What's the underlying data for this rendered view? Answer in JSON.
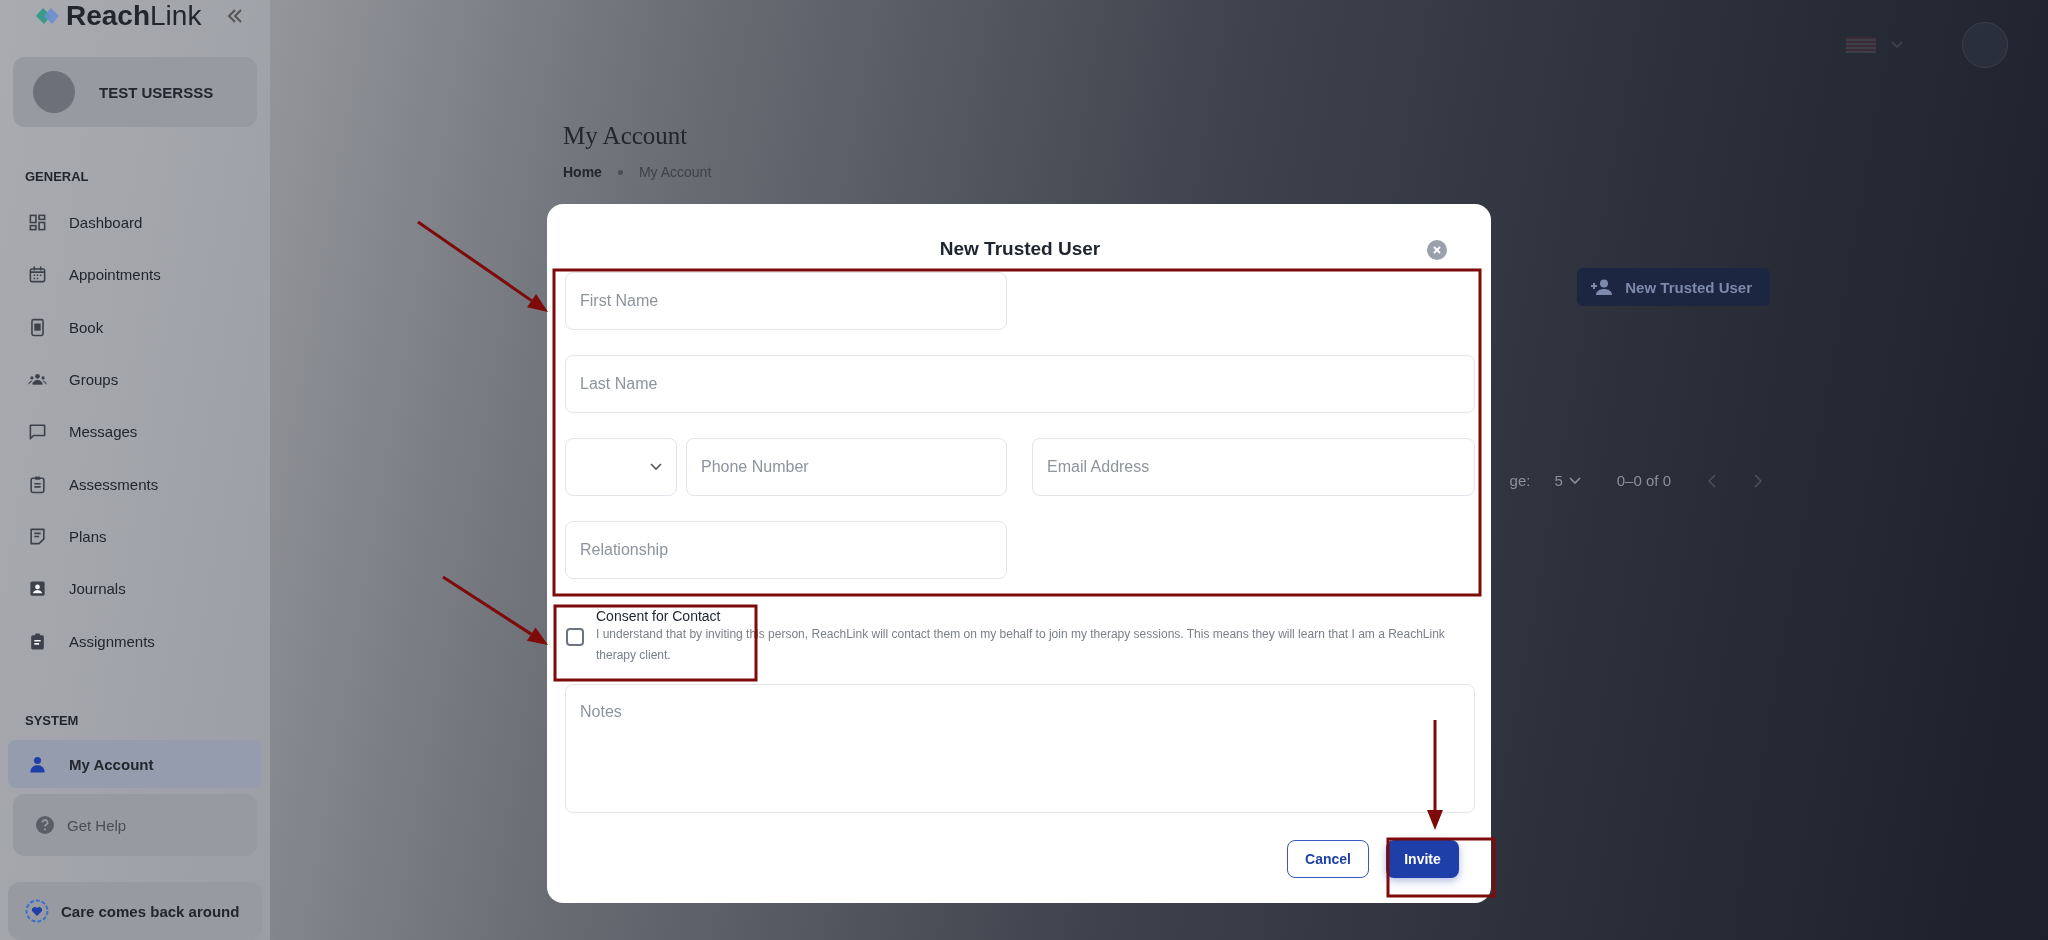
{
  "sidebar": {
    "logo": "**Reach**Link",
    "user_name": "TEST USERSSS",
    "sections": [
      {
        "title": "GENERAL",
        "items": [
          {
            "label": "Dashboard",
            "selected": false
          },
          {
            "label": "Appointments",
            "selected": false
          },
          {
            "label": "Book",
            "selected": false
          },
          {
            "label": "Groups",
            "selected": false
          },
          {
            "label": "Messages",
            "selected": false
          },
          {
            "label": "Assessments",
            "selected": false
          },
          {
            "label": "Plans",
            "selected": false
          },
          {
            "label": "Journals",
            "selected": false
          },
          {
            "label": "Assignments",
            "selected": false
          }
        ]
      },
      {
        "title": "SYSTEM",
        "items": [
          {
            "label": "My Account",
            "selected": true
          }
        ]
      }
    ],
    "help": "Get Help",
    "footer": "Care comes back around"
  },
  "page": {
    "title": "My Account",
    "breadcrumb": [
      "Home",
      "My Account"
    ],
    "new_button": "New Trusted User",
    "pagination": {
      "rows_label": "ge:",
      "rows_value": "5",
      "range": "0–0 of 0"
    }
  },
  "modal": {
    "title": "New Trusted User",
    "fields": [
      {
        "kind": "text",
        "placeholder": "First Name"
      },
      {
        "kind": "text",
        "placeholder": "Last Name"
      },
      {
        "kind": "select"
      },
      {
        "kind": "text",
        "placeholder": "Phone Number"
      },
      {
        "kind": "text",
        "placeholder": "Email Address"
      },
      {
        "kind": "text",
        "placeholder": "Relationship"
      }
    ],
    "consent": {
      "checked": false,
      "title": "Consent for Contact",
      "text": "I understand that by inviting this person, ReachLink will contact them on my behalf to join my therapy sessions. This means they will learn that I am a ReachLink therapy client."
    },
    "notes": {
      "placeholder": "Notes"
    },
    "buttons": [
      {
        "label": "Cancel",
        "kind": "secondary"
      },
      {
        "label": "Invite",
        "kind": "primary"
      }
    ]
  }
}
